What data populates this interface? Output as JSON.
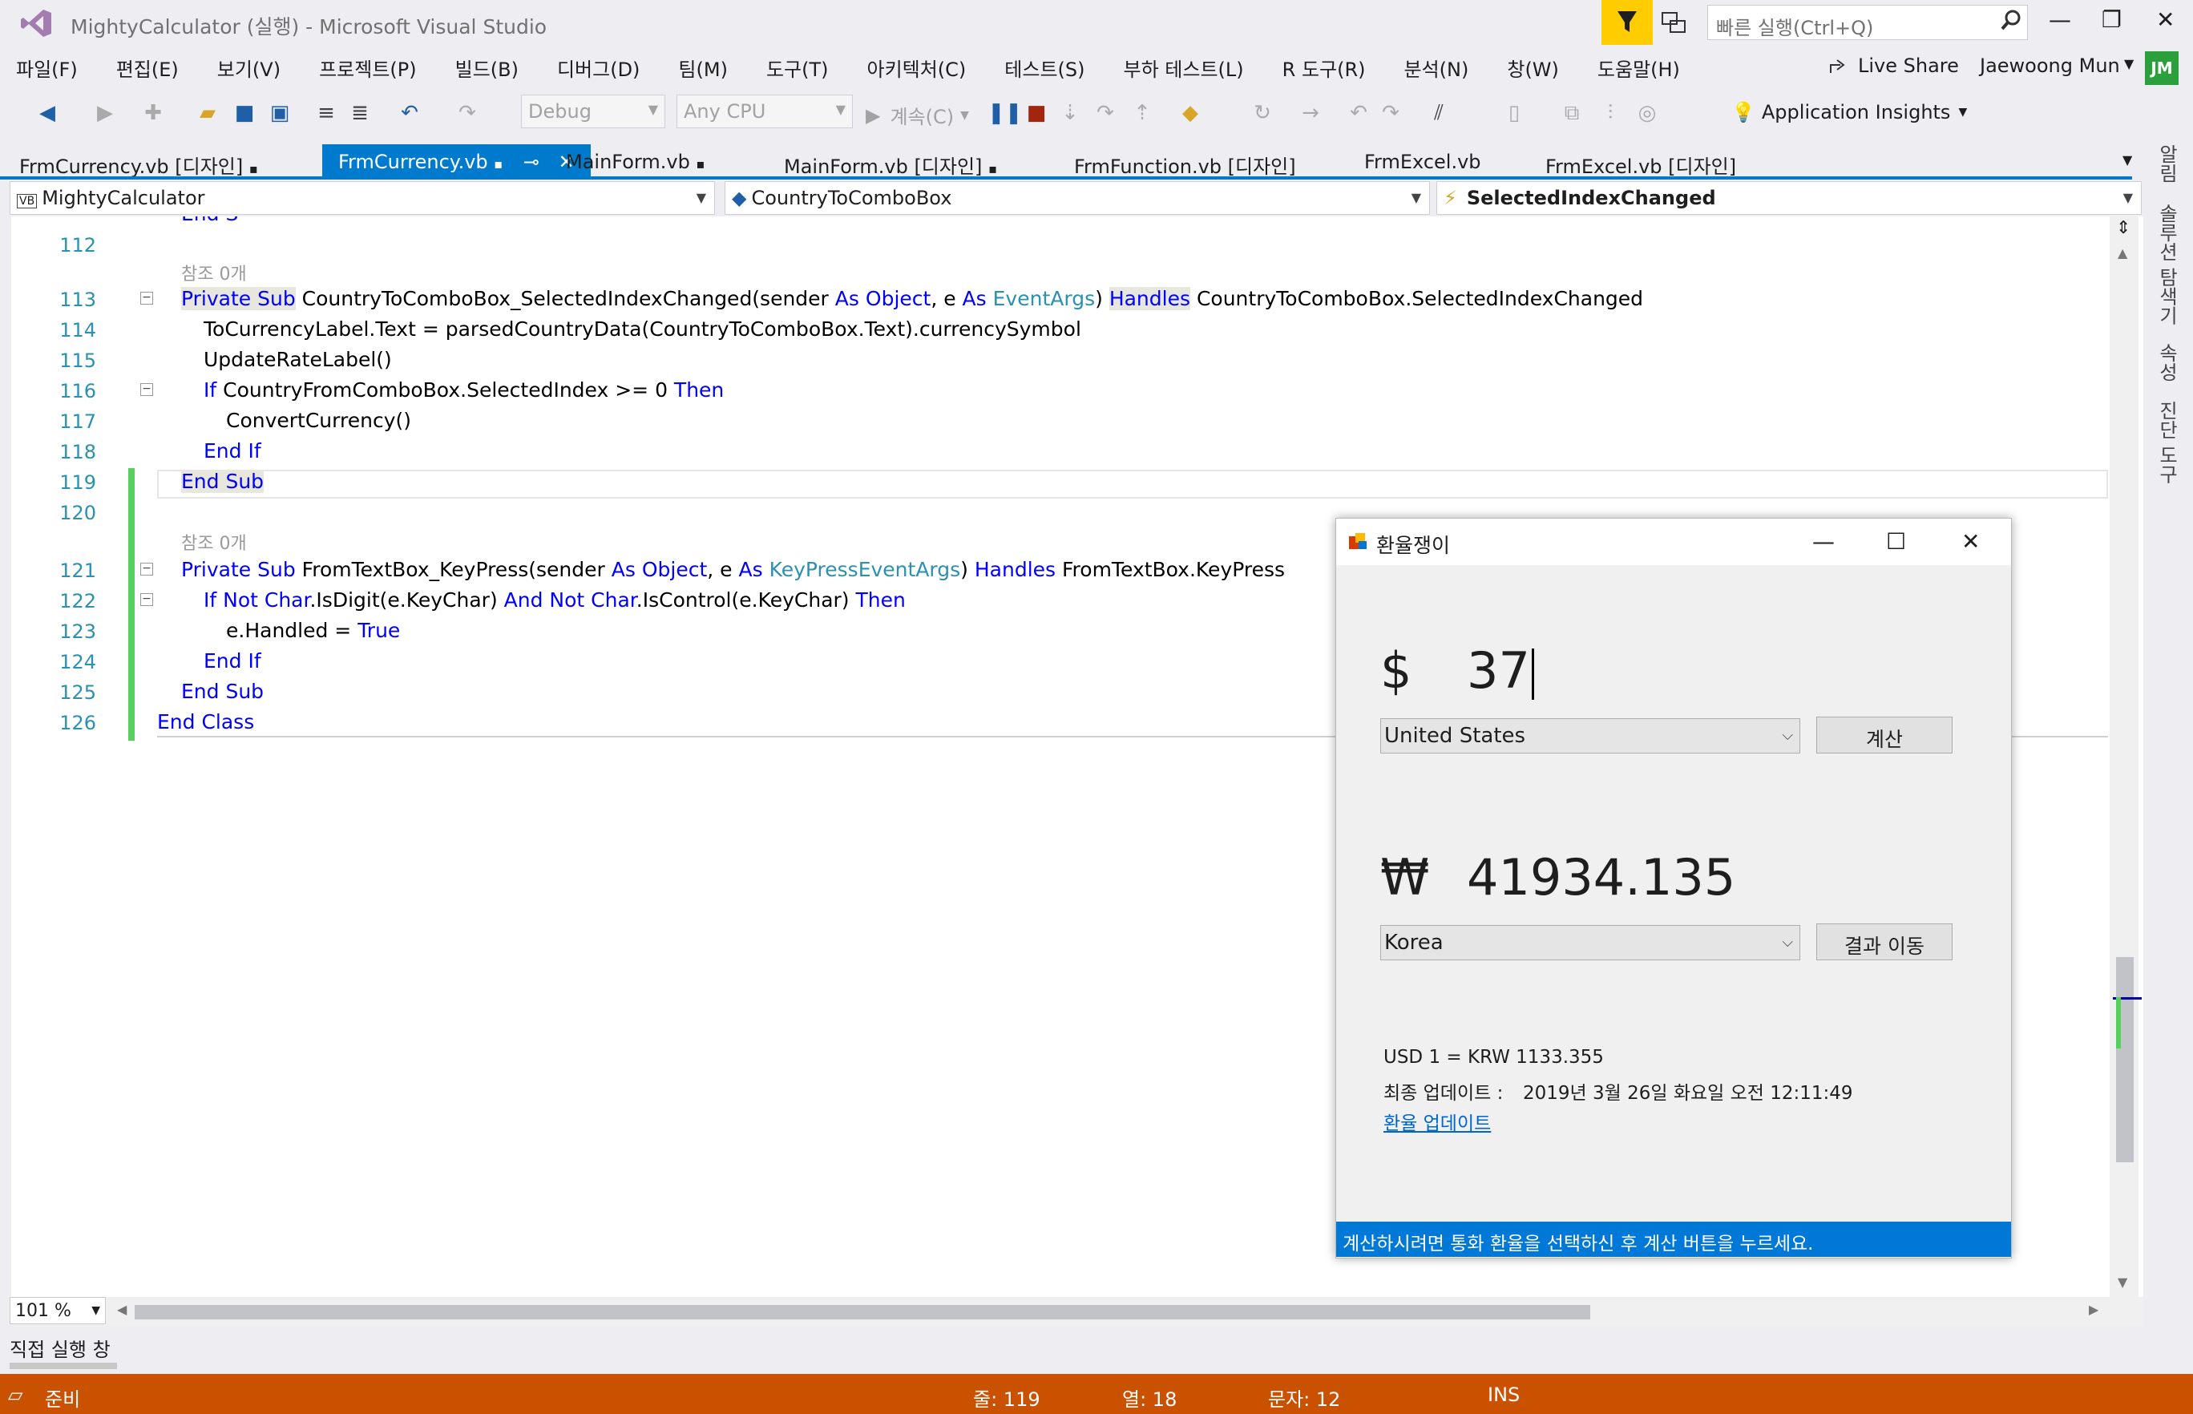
{
  "window": {
    "title": "MightyCalculator (실행) - Microsoft Visual Studio",
    "search_placeholder": "빠른 실행(Ctrl+Q)"
  },
  "menu": [
    "파일(F)",
    "편집(E)",
    "보기(V)",
    "프로젝트(P)",
    "빌드(B)",
    "디버그(D)",
    "팀(M)",
    "도구(T)",
    "아키텍처(C)",
    "테스트(S)",
    "부하 테스트(L)",
    "R 도구(R)",
    "분석(N)",
    "창(W)",
    "도움말(H)"
  ],
  "account": {
    "live_share": "Live Share",
    "user": "Jaewoong Mun",
    "initials": "JM"
  },
  "toolbar": {
    "config": "Debug",
    "platform": "Any CPU",
    "continue": "계속(C)",
    "app_insights": "Application Insights"
  },
  "tabs": [
    {
      "label": "FrmCurrency.vb [디자인]"
    },
    {
      "label": "FrmCurrency.vb"
    },
    {
      "label": "MainForm.vb"
    },
    {
      "label": "MainForm.vb [디자인]"
    },
    {
      "label": "FrmFunction.vb [디자인]"
    },
    {
      "label": "FrmExcel.vb"
    },
    {
      "label": "FrmExcel.vb [디자인]"
    }
  ],
  "navbar": {
    "project": "MightyCalculator",
    "object": "CountryToComboBox",
    "event": "SelectedIndexChanged"
  },
  "editor": {
    "ref0": "참조 0개",
    "lines": [
      {
        "n": "112"
      },
      {
        "n": "113",
        "parts": [
          "Private Sub",
          " CountryToComboBox_SelectedIndexChanged(sender ",
          "As",
          " ",
          "Object",
          ", e ",
          "As",
          " ",
          "EventArgs",
          ") ",
          "Handles",
          " CountryToComboBox.SelectedIndexChanged"
        ]
      },
      {
        "n": "114",
        "text": "ToCurrencyLabel.Text = parsedCountryData(CountryToComboBox.Text).currencySymbol"
      },
      {
        "n": "115",
        "text": "UpdateRateLabel()"
      },
      {
        "n": "116",
        "parts": [
          "If",
          " CountryFromComboBox.SelectedIndex >= 0 ",
          "Then"
        ]
      },
      {
        "n": "117",
        "text": "ConvertCurrency()"
      },
      {
        "n": "118",
        "text": "End If"
      },
      {
        "n": "119",
        "text": "End Sub"
      },
      {
        "n": "120"
      },
      {
        "n": "121",
        "parts": [
          "Private Sub",
          " FromTextBox_KeyPress(sender ",
          "As",
          " ",
          "Object",
          ", e ",
          "As",
          " ",
          "KeyPressEventArgs",
          ") ",
          "Handles",
          " FromTextBox.KeyPress"
        ]
      },
      {
        "n": "122",
        "parts": [
          "If Not",
          " ",
          "Char",
          ".IsDigit(e.KeyChar) ",
          "And Not",
          " ",
          "Char",
          ".IsControl(e.KeyChar) ",
          "Then"
        ]
      },
      {
        "n": "123",
        "parts": [
          "e.Handled = ",
          "True"
        ]
      },
      {
        "n": "124",
        "text": "End If"
      },
      {
        "n": "125",
        "text": "End Sub"
      },
      {
        "n": "126",
        "text": "End Class"
      }
    ],
    "zoom": "101 %"
  },
  "sidebar": [
    "알림",
    "솔루션 탐색기",
    "속성",
    "진단 도구"
  ],
  "bottom": {
    "immediate": "직접 실행 창"
  },
  "status": {
    "ready": "준비",
    "line": "줄: 119",
    "col": "열: 18",
    "char": "문자: 12",
    "mode": "INS"
  },
  "form": {
    "title": "환율쟁이",
    "from_symbol": "$",
    "from_value": "37",
    "from_country": "United States",
    "calc_button": "계산",
    "to_symbol": "₩",
    "to_value": "41934.135",
    "to_country": "Korea",
    "move_button": "결과 이동",
    "rate": "USD 1 = KRW 1133.355",
    "last_update_label": "최종 업데이트 :",
    "last_update_value": "2019년 3월 26일 화요일 오전 12:11:49",
    "update_link": "환율 업데이트",
    "status": "계산하시려면 통화 환율을 선택하신 후 계산 버튼을 누르세요."
  },
  "colors": {
    "accent": "#007acc",
    "status_bar": "#ca5100",
    "keyword": "#0000ff",
    "type": "#2b91af",
    "changed": "#57d05f",
    "form_status": "#0078d7"
  }
}
